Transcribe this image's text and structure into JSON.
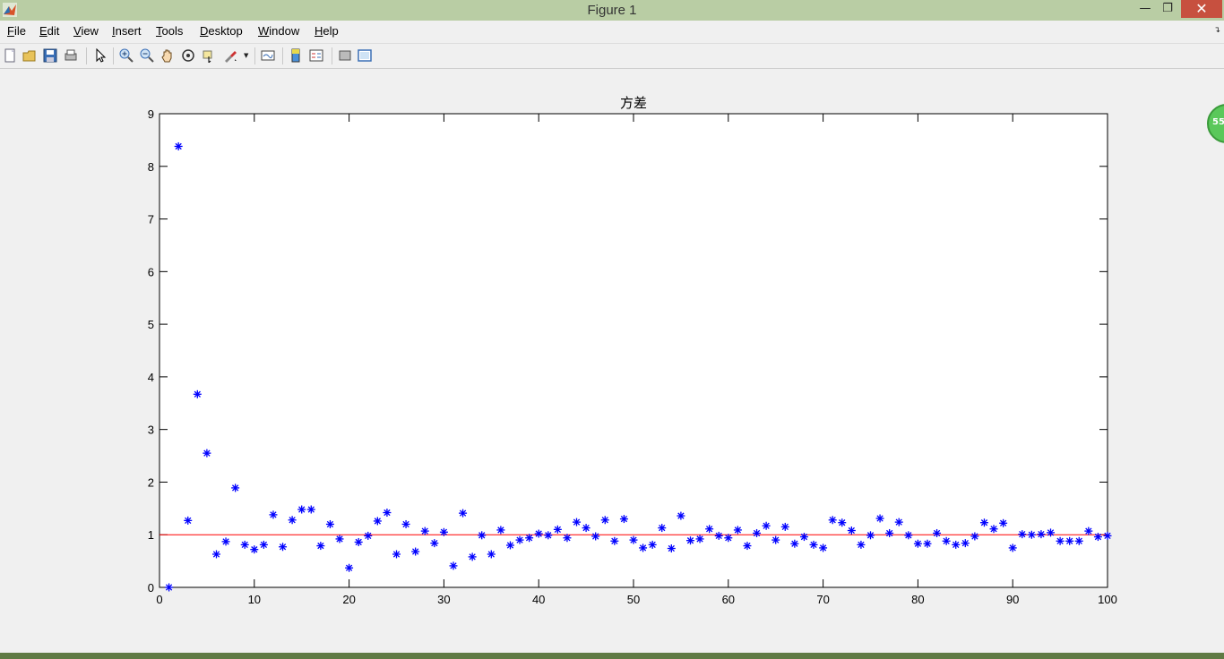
{
  "window": {
    "title": "Figure 1"
  },
  "menu": [
    {
      "pre": "",
      "ul": "F",
      "post": "ile"
    },
    {
      "pre": "",
      "ul": "E",
      "post": "dit"
    },
    {
      "pre": "",
      "ul": "V",
      "post": "iew"
    },
    {
      "pre": "",
      "ul": "I",
      "post": "nsert"
    },
    {
      "pre": "",
      "ul": "T",
      "post": "ools"
    },
    {
      "pre": "",
      "ul": "D",
      "post": "esktop"
    },
    {
      "pre": "",
      "ul": "W",
      "post": "indow"
    },
    {
      "pre": "",
      "ul": "H",
      "post": "elp"
    }
  ],
  "toolbar": [
    "new-figure",
    "open-file",
    "save-figure",
    "print-figure",
    "edit-plot",
    "zoom-in",
    "zoom-out",
    "pan",
    "rotate-3d",
    "data-cursor",
    "brush",
    "link-plot",
    "colorbar",
    "legend",
    "hide-plot-tools",
    "show-plot-tools"
  ],
  "badge": {
    "text": "55"
  },
  "chart_data": {
    "type": "scatter",
    "title": "方差",
    "xlabel": "",
    "ylabel": "",
    "xlim": [
      0,
      100
    ],
    "ylim": [
      0,
      9
    ],
    "xticks": [
      0,
      10,
      20,
      30,
      40,
      50,
      60,
      70,
      80,
      90,
      100
    ],
    "yticks": [
      0,
      1,
      2,
      3,
      4,
      5,
      6,
      7,
      8,
      9
    ],
    "marker": "*",
    "marker_color": "#0000ff",
    "reference_line": {
      "y": 1,
      "color": "#ff0000"
    },
    "x": [
      1,
      2,
      3,
      4,
      5,
      6,
      7,
      8,
      9,
      10,
      11,
      12,
      13,
      14,
      15,
      16,
      17,
      18,
      19,
      20,
      21,
      22,
      23,
      24,
      25,
      26,
      27,
      28,
      29,
      30,
      31,
      32,
      33,
      34,
      35,
      36,
      37,
      38,
      39,
      40,
      41,
      42,
      43,
      44,
      45,
      46,
      47,
      48,
      49,
      50,
      51,
      52,
      53,
      54,
      55,
      56,
      57,
      58,
      59,
      60,
      61,
      62,
      63,
      64,
      65,
      66,
      67,
      68,
      69,
      70,
      71,
      72,
      73,
      74,
      75,
      76,
      77,
      78,
      79,
      80,
      81,
      82,
      83,
      84,
      85,
      86,
      87,
      88,
      89,
      90,
      91,
      92,
      93,
      94,
      95,
      96,
      97,
      98,
      99,
      100
    ],
    "y": [
      0,
      8.38,
      1.27,
      3.67,
      2.55,
      0.63,
      0.87,
      1.89,
      0.81,
      0.72,
      0.81,
      1.38,
      0.77,
      1.28,
      1.48,
      1.48,
      0.79,
      1.2,
      0.92,
      0.37,
      0.86,
      0.98,
      1.26,
      1.42,
      0.63,
      1.2,
      0.68,
      1.07,
      0.84,
      1.05,
      0.41,
      1.41,
      0.58,
      0.99,
      0.63,
      1.09,
      0.8,
      0.9,
      0.94,
      1.02,
      0.99,
      1.1,
      0.94,
      1.24,
      1.13,
      0.97,
      1.28,
      0.88,
      1.3,
      0.9,
      0.75,
      0.81,
      1.13,
      0.74,
      1.36,
      0.89,
      0.92,
      1.11,
      0.98,
      0.94,
      1.09,
      0.79,
      1.03,
      1.17,
      0.9,
      1.15,
      0.83,
      0.96,
      0.81,
      0.75,
      1.28,
      1.23,
      1.08,
      0.81,
      0.99,
      1.31,
      1.03,
      1.24,
      0.99,
      0.83,
      0.83,
      1.03,
      0.88,
      0.81,
      0.84,
      0.97,
      1.23,
      1.11,
      1.22,
      0.75,
      1.01,
      1.0,
      1.01,
      1.04,
      0.88,
      0.88,
      0.88,
      1.07,
      0.96,
      0.98
    ]
  }
}
